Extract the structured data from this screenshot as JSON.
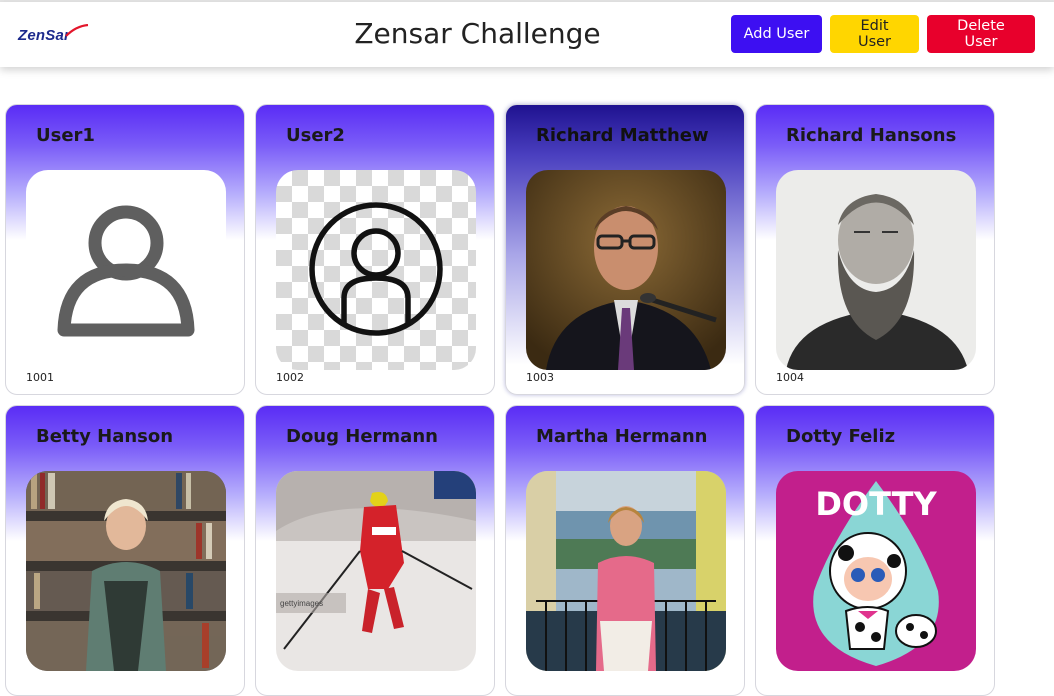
{
  "header": {
    "logo_text": "ZenSar",
    "title": "Zensar Challenge",
    "buttons": {
      "add": "Add User",
      "edit": "Edit User",
      "delete": "Delete User"
    }
  },
  "colors": {
    "add_button": "#3d0ff2",
    "edit_button": "#ffd600",
    "delete_button": "#e8002c",
    "card_gradient_top": "#5a2cf5"
  },
  "users": [
    {
      "name": "User1",
      "id": "1001",
      "avatar": "person-outline-icon"
    },
    {
      "name": "User2",
      "id": "1002",
      "avatar": "user-circle-icon"
    },
    {
      "name": "Richard Matthew",
      "id": "1003",
      "avatar": "photo"
    },
    {
      "name": "Richard Hansons",
      "id": "1004",
      "avatar": "photo"
    },
    {
      "name": "Betty Hanson",
      "id": "",
      "avatar": "photo"
    },
    {
      "name": "Doug Hermann",
      "id": "",
      "avatar": "photo"
    },
    {
      "name": "Martha Hermann",
      "id": "",
      "avatar": "photo"
    },
    {
      "name": "Dotty Feliz",
      "id": "",
      "avatar": "photo"
    }
  ],
  "photo_texts": {
    "dotty_title": "DOTTY",
    "getty_watermark": "gettyimages"
  }
}
